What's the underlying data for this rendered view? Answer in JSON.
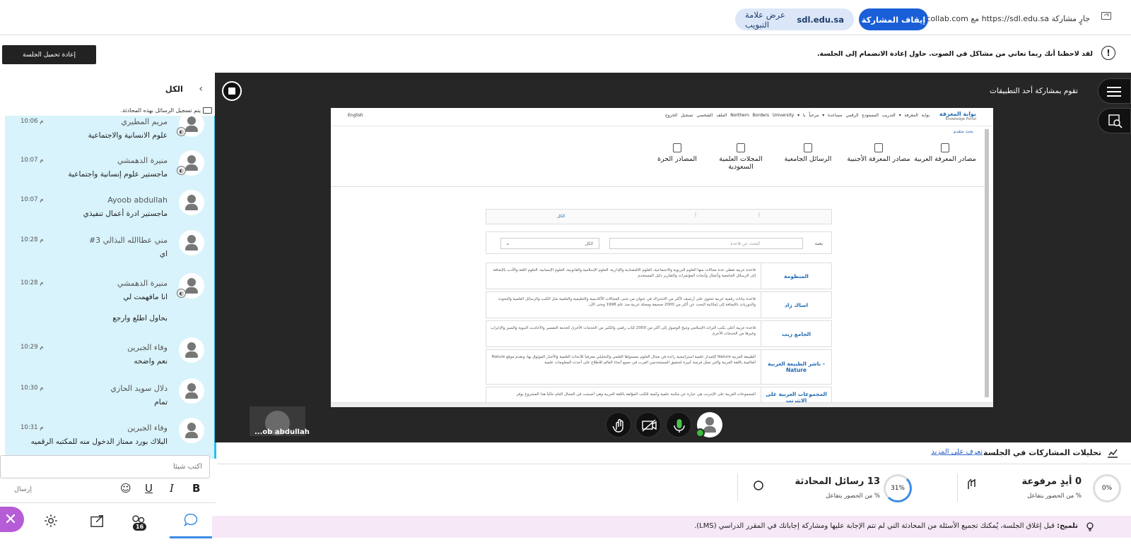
{
  "sharebar": {
    "share_text": "جارٍ مشاركة https://sdl.edu.sa مع eu.bbcollab.com",
    "stop_label": "إيقاف المشاركة",
    "show_tab_label": "عرض علامة التبويب",
    "domain": "sdl.edu.sa"
  },
  "alert": {
    "text": "لقد لاحظنا أنك ربما تعاني من مشاكل في الصوت. حاول إعادة الانضمام إلى الجلسة.",
    "icon": "!",
    "reload_label": "إعادة تحميل الجلسة"
  },
  "chat": {
    "title": "الكل",
    "recording_note": "يتم تسجيل الرسائل بهذه المحادثة.",
    "messages": [
      {
        "name": "مريم المطيري",
        "time": "10:06 م",
        "text": "علوم الانسانية والاجتماعية",
        "text2": ""
      },
      {
        "name": "منيرة الدهمشي",
        "time": "10:07 م",
        "text": "ماجستير علوم إنسانية واجتماعية",
        "text2": ""
      },
      {
        "name": "Ayoob abdullah",
        "time": "10:07 م",
        "text": "ماجستير ادرة أعمال تنفيذي",
        "text2": ""
      },
      {
        "name": "مني عطاالله البذالي 3#",
        "time": "10:28 م",
        "text": "اي",
        "text2": ""
      },
      {
        "name": "منيرة الدهمشي",
        "time": "10:28 م",
        "text": "انا مافهمت لي",
        "text2": "بحاول اطلع وارجع"
      },
      {
        "name": "وفاء الجبرين",
        "time": "10:29 م",
        "text": "نعم واضحه",
        "text2": ""
      },
      {
        "name": "دلال سويد الحازي",
        "time": "10:30 م",
        "text": "تمام",
        "text2": ""
      },
      {
        "name": "وفاء الجبرين",
        "time": "10:31 م",
        "text": "البلاك بورد ممتاز الدخول منه للمكتبه الرقميه",
        "text2": ""
      }
    ],
    "input_placeholder": "اكتب شيئاً",
    "send_label": "إرسال",
    "format": {
      "bold": "B",
      "italic": "I",
      "underline": "U",
      "emoji": "☺"
    }
  },
  "nav": {
    "close": "✕",
    "participants_count": "16"
  },
  "stage": {
    "title": "تقوم بمشاركة أحد التطبيقات",
    "presenter_name": "...ob abdullah"
  },
  "shared_page": {
    "logo_ar": "بوابة المعرفة",
    "logo_en": "Knowledge Portal",
    "nav": "بوابة المعرفة ▾   التدريب   المستودع الرقمي   مساعدة ▾   مرحباً يا ▾   Northern Borders University   الملف الشخصي   تسجيل الخروج",
    "english": "English",
    "advanced": "بحث متقدم",
    "categories": [
      {
        "label": "مصادر المعرفة العربية"
      },
      {
        "label": "مصادر المعرفة الأجنبية"
      },
      {
        "label": "الرسائل الجامعية"
      },
      {
        "label": "المجلات العلمية السعودية"
      },
      {
        "label": "المصادر الحرة"
      }
    ],
    "tab_all": "الكل",
    "search_label": "بحث",
    "search_placeholder": "البحث عن قاعدة",
    "select_value": "الكل",
    "databases": [
      {
        "title": "المنظومة",
        "desc": "قاعدة عربية تغطي عدة مجالات منها العلوم التربوية والاجتماعية، العلوم الاقتصادية والإدارية، العلوم الإسلامية والقانونية، العلوم الإنسانية، العلوم اللغة والأدب بالإضافة إلى الرسائل الجامعية وأعمال وأبحاث المؤتمرات والتقارير دليل المستخدم"
      },
      {
        "title": "اساك زاد",
        "desc": "قاعدة بيانات رقمية عربية تحتوي على أرشيف لأكثر من الاشتراك في عنوان من شتى المجالات الأكاديمية والتعليمية والعلمية مثل الكتب والرسائل العلمية والبحوث والدوريات بالإضافة إلى إمكانية البحث عن أكثر من 2000 صحيفة ومجلة عربية منذ عام 1998 وحتى الآن"
      },
      {
        "title": "الجامع زيب",
        "desc": "قاعدة عربية أعلى بكتب التراث الإسلامي وتتيح الوصول إلى أكثر من 2000 كتاب رقمي والكثير من الخدمات الأخرى كخدمة التفسير والأحاديث النبوية والسير والإعراب وغيرها من الخدمات الأخرى"
      },
      {
        "title": "- ناشر الطبيعة العربية Nature",
        "desc": "الطبيعة العربية Nature كإصدار علمية استراتيجية رائدة في مجال العلوم بمستواها العلمي والتحليلي معرفياً للأبحاث العلمية والأخبار الموثوق بها، وتقدم موقع Nature العالمية باللغة العربية والتي تمثل فرصة كبيرة لتحقيق المستخدمين العرب في جميع أنحاء العالم للاطلاع على أحدث المعلومات علمية"
      },
      {
        "title": "المجموعات العربية على الإنترنت",
        "desc": "المجموعات العربية على الإنترنت هي عبارة عن مكتبة علمية وكمية للكتب المؤلفة باللغة العربية وهي أصبحت في المجال العام حالياً هذا المشروع يوفر"
      }
    ]
  },
  "analytics": {
    "title": "تحليلات المشاركات في الجلسة",
    "link": "تعرف على المزيد",
    "hands_value": "0 أيدٍ مرفوعة",
    "hands_ring": "0%",
    "hands_sub": "% من الحضور يتفاعل",
    "messages_value": "13 رسائل المحادثة",
    "messages_ring": "31%",
    "messages_sub": "% من الحضور يتفاعل"
  },
  "tip": {
    "label": "تلميح:",
    "text": "قبل إغلاق الجلسة، يُمكنك تجميع الأسئلة من المحادثة التي لم تتم الإجابة عليها ومشاركة إجاباتك في المقرر الدراسي (LMS)."
  }
}
